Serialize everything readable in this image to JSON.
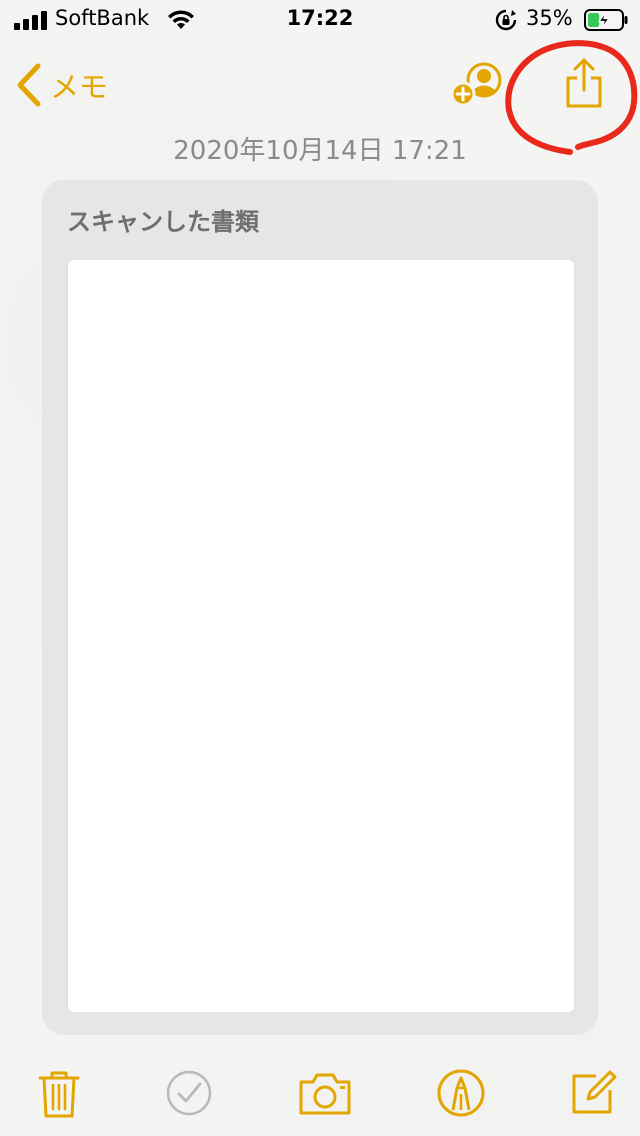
{
  "status_bar": {
    "carrier": "SoftBank",
    "time": "17:22",
    "battery_percent": "35%",
    "battery_level": 0.35
  },
  "nav": {
    "back_label": "メモ"
  },
  "note": {
    "date": "2020年10月14日 17:21",
    "scan_title": "スキャンした書類"
  },
  "colors": {
    "accent": "#e3a500",
    "annotation": "#e8291c",
    "date_text": "#8a8a8a",
    "card_bg": "#e6e6e6"
  },
  "icons": {
    "back": "chevron-left-icon",
    "add_person": "add-person-icon",
    "share": "share-icon",
    "trash": "trash-icon",
    "checklist": "checkmark-circle-icon",
    "camera": "camera-icon",
    "markup": "markup-pen-icon",
    "compose": "compose-icon"
  }
}
